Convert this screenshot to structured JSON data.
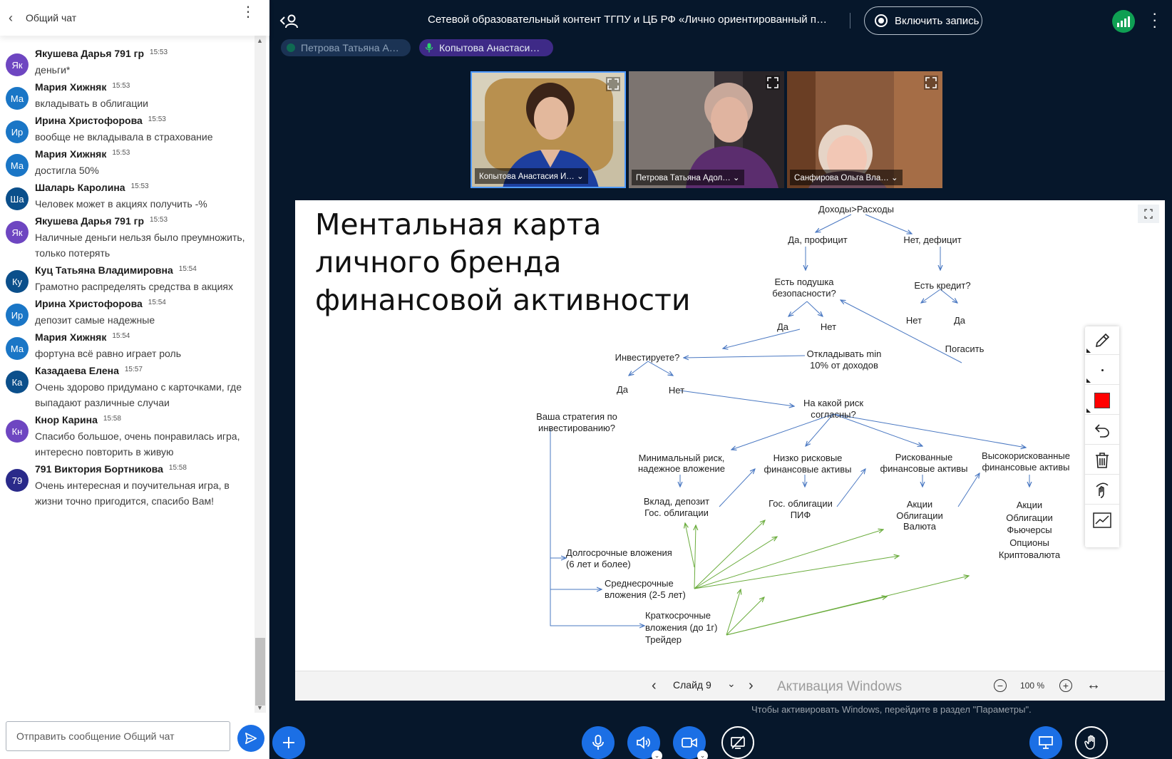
{
  "chat": {
    "title": "Общий чат",
    "messages": [
      {
        "initials": "Як",
        "color": "#6e46c1",
        "name": "Якушева Дарья 791 гр",
        "time": "15:53",
        "text": "деньги*"
      },
      {
        "initials": "Ма",
        "color": "#1a76c6",
        "name": "Мария Хижняк",
        "time": "15:53",
        "text": "вкладывать в облигации"
      },
      {
        "initials": "Ир",
        "color": "#1a76c6",
        "name": "Ирина Христофорова",
        "time": "15:53",
        "text": "вообще не вкладывала в страхование"
      },
      {
        "initials": "Ма",
        "color": "#1a76c6",
        "name": "Мария Хижняк",
        "time": "15:53",
        "text": "достигла 50%"
      },
      {
        "initials": "Ша",
        "color": "#0b4f8b",
        "name": "Шаларь Каролина",
        "time": "15:53",
        "text": "Человек может в акциях получить -%"
      },
      {
        "initials": "Як",
        "color": "#6e46c1",
        "name": "Якушева Дарья 791 гр",
        "time": "15:53",
        "text": "Наличные деньги нельзя было преумножить, только потерять"
      },
      {
        "initials": "Ку",
        "color": "#0b4f8b",
        "name": "Куц Татьяна Владимировна",
        "time": "15:54",
        "text": "Грамотно распределять средства в акциях"
      },
      {
        "initials": "Ир",
        "color": "#1a76c6",
        "name": "Ирина Христофорова",
        "time": "15:54",
        "text": "депозит самые надежные"
      },
      {
        "initials": "Ма",
        "color": "#1a76c6",
        "name": "Мария Хижняк",
        "time": "15:54",
        "text": "фортуна всё равно играет роль"
      },
      {
        "initials": "Ка",
        "color": "#0b4f8b",
        "name": "Казадаева Елена",
        "time": "15:57",
        "text": "Очень здорово придумано с карточками, где выпадают различные случаи"
      },
      {
        "initials": "Кн",
        "color": "#6e46c1",
        "name": "Кнор Карина",
        "time": "15:58",
        "text": "Спасибо большое, очень понравилась игра, интересно повторить в живую"
      },
      {
        "initials": "79",
        "color": "#2a2a8a",
        "name": "791 Виктория Бортникова",
        "time": "15:58",
        "text": "Очень интересная и поучительная игра, в жизни точно пригодится, спасибо Вам!"
      }
    ],
    "input_placeholder": "Отправить сообщение Общий чат"
  },
  "meeting": {
    "title": "Сетевой образовательный контент ТГПУ и ЦБ РФ «Лично ориентированный под…",
    "record_label": "Включить запись",
    "talkers": [
      "Петрова Татьяна А…",
      "Копытова Анастаси…"
    ]
  },
  "videos": [
    {
      "name": "Копытова Анастасия И… ⌄"
    },
    {
      "name": "Петрова Татьяна Адол… ⌄"
    },
    {
      "name": "Санфирова Ольга Вла… ⌄"
    }
  ],
  "slide": {
    "title_lines": [
      "Ментальная карта",
      "личного бренда",
      "финансовой активности"
    ],
    "nodes": {
      "income": "Доходы>Расходы",
      "surplus": "Да, профицит",
      "deficit": "Нет, дефицит",
      "cushion_1": "Есть подушка",
      "cushion_2": "безопасности?",
      "credit": "Есть кредит?",
      "credit_no": "Нет",
      "credit_yes": "Да",
      "pay_off": "Погасить",
      "cushion_yes": "Да",
      "cushion_no": "Нет",
      "save_1": "Откладывать min",
      "save_2": "10% от доходов",
      "invest": "Инвестируете?",
      "invest_yes": "Да",
      "invest_no": "Нет",
      "strategy_1": "Ваша стратегия по",
      "strategy_2": "инвестированию?",
      "risk_1": "На какой риск",
      "risk_2": "согласны?",
      "minrisk_1": "Минимальный риск,",
      "minrisk_2": "надежное вложение",
      "lowrisk_1": "Низко рисковые",
      "lowrisk_2": "финансовые активы",
      "risky_1": "Рискованные",
      "risky_2": "финансовые активы",
      "highrisk_1": "Высокорискованные",
      "highrisk_2": "финансовые активы",
      "deposit_1": "Вклад, депозит",
      "deposit_2": "Гос. облигации",
      "gov_1": "Гос. облигации",
      "gov_2": "ПИФ",
      "stocks_a": [
        "Акции",
        "Облигации",
        "Валюта"
      ],
      "stocks_b": [
        "Акции",
        "Облигации",
        "Фьючерсы",
        "Опционы",
        "Криптовалюта"
      ],
      "long_1": "Долгосрочные  вложения",
      "long_2": "(6 лет и более)",
      "mid_1": "Среднесрочные",
      "mid_2": "вложения (2-5 лет)",
      "short_1": "Краткосрочные",
      "short_2": "вложения (до 1г)",
      "short_3": "Трейдер"
    },
    "nav": {
      "label": "Слайд 9",
      "zoom": "100 %"
    }
  },
  "watermark": {
    "line1": "Активация Windows",
    "line2": "Чтобы активировать Windows, перейдите в раздел \"Параметры\"."
  },
  "colors": {
    "primary": "#1b6fe5",
    "dark_bg": "#06172b",
    "arrow_blue": "#4a78c2",
    "arrow_green": "#6aac3c",
    "whiteboard_color": "#ff0000"
  }
}
